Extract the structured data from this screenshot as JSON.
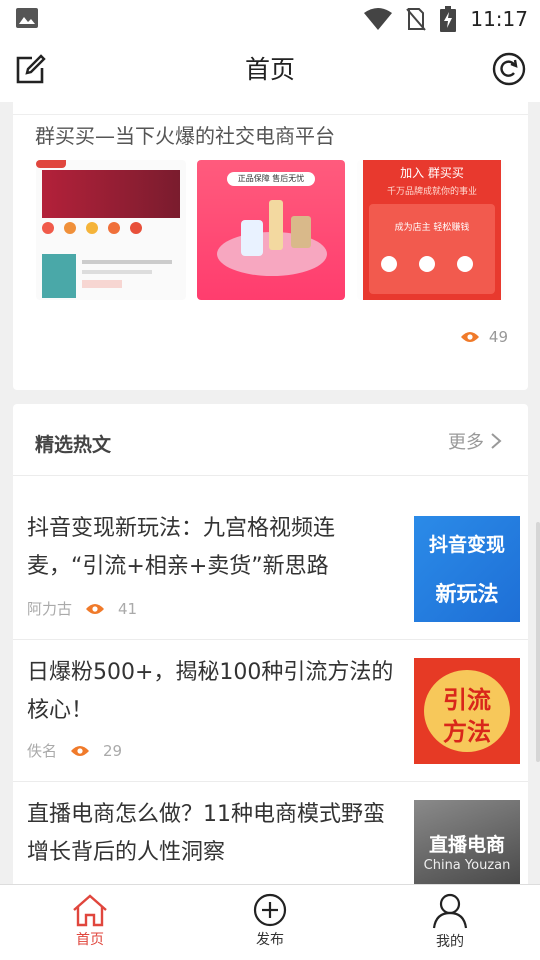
{
  "status_bar": {
    "time": "11:17"
  },
  "header": {
    "title": "首页"
  },
  "promo": {
    "title": "群买买—当下火爆的社交电商平台",
    "views": "49",
    "img_b_caption": "正品保障 售后无忧",
    "img_c_title": "加入 群买买",
    "img_c_sub": "千万品牌成就你的事业",
    "img_c_cta": "成为店主  轻松赚钱"
  },
  "hot_section": {
    "title": "精选热文",
    "more_label": "更多"
  },
  "articles": [
    {
      "headline": "抖音变现新玩法：九宫格视频连麦，“引流+相亲+卖货”新思路",
      "author": "阿力古",
      "views": "41",
      "thumb_line1": "抖音变现",
      "thumb_line2": "新玩法"
    },
    {
      "headline": "日爆粉500+，揭秘100种引流方法的核心！",
      "author": "佚名",
      "views": "29",
      "thumb_line1": "引流",
      "thumb_line2": "方法"
    },
    {
      "headline": "直播电商怎么做？11种电商模式野蛮增长背后的人性洞察",
      "author": "",
      "views": "",
      "thumb_line1": "直播电商",
      "thumb_line2": "China Youzan"
    }
  ],
  "bottom_nav": [
    {
      "label": "首页"
    },
    {
      "label": "发布"
    },
    {
      "label": "我的"
    }
  ],
  "colors": {
    "accent": "#e0463d",
    "eye": "#f07a2a"
  }
}
